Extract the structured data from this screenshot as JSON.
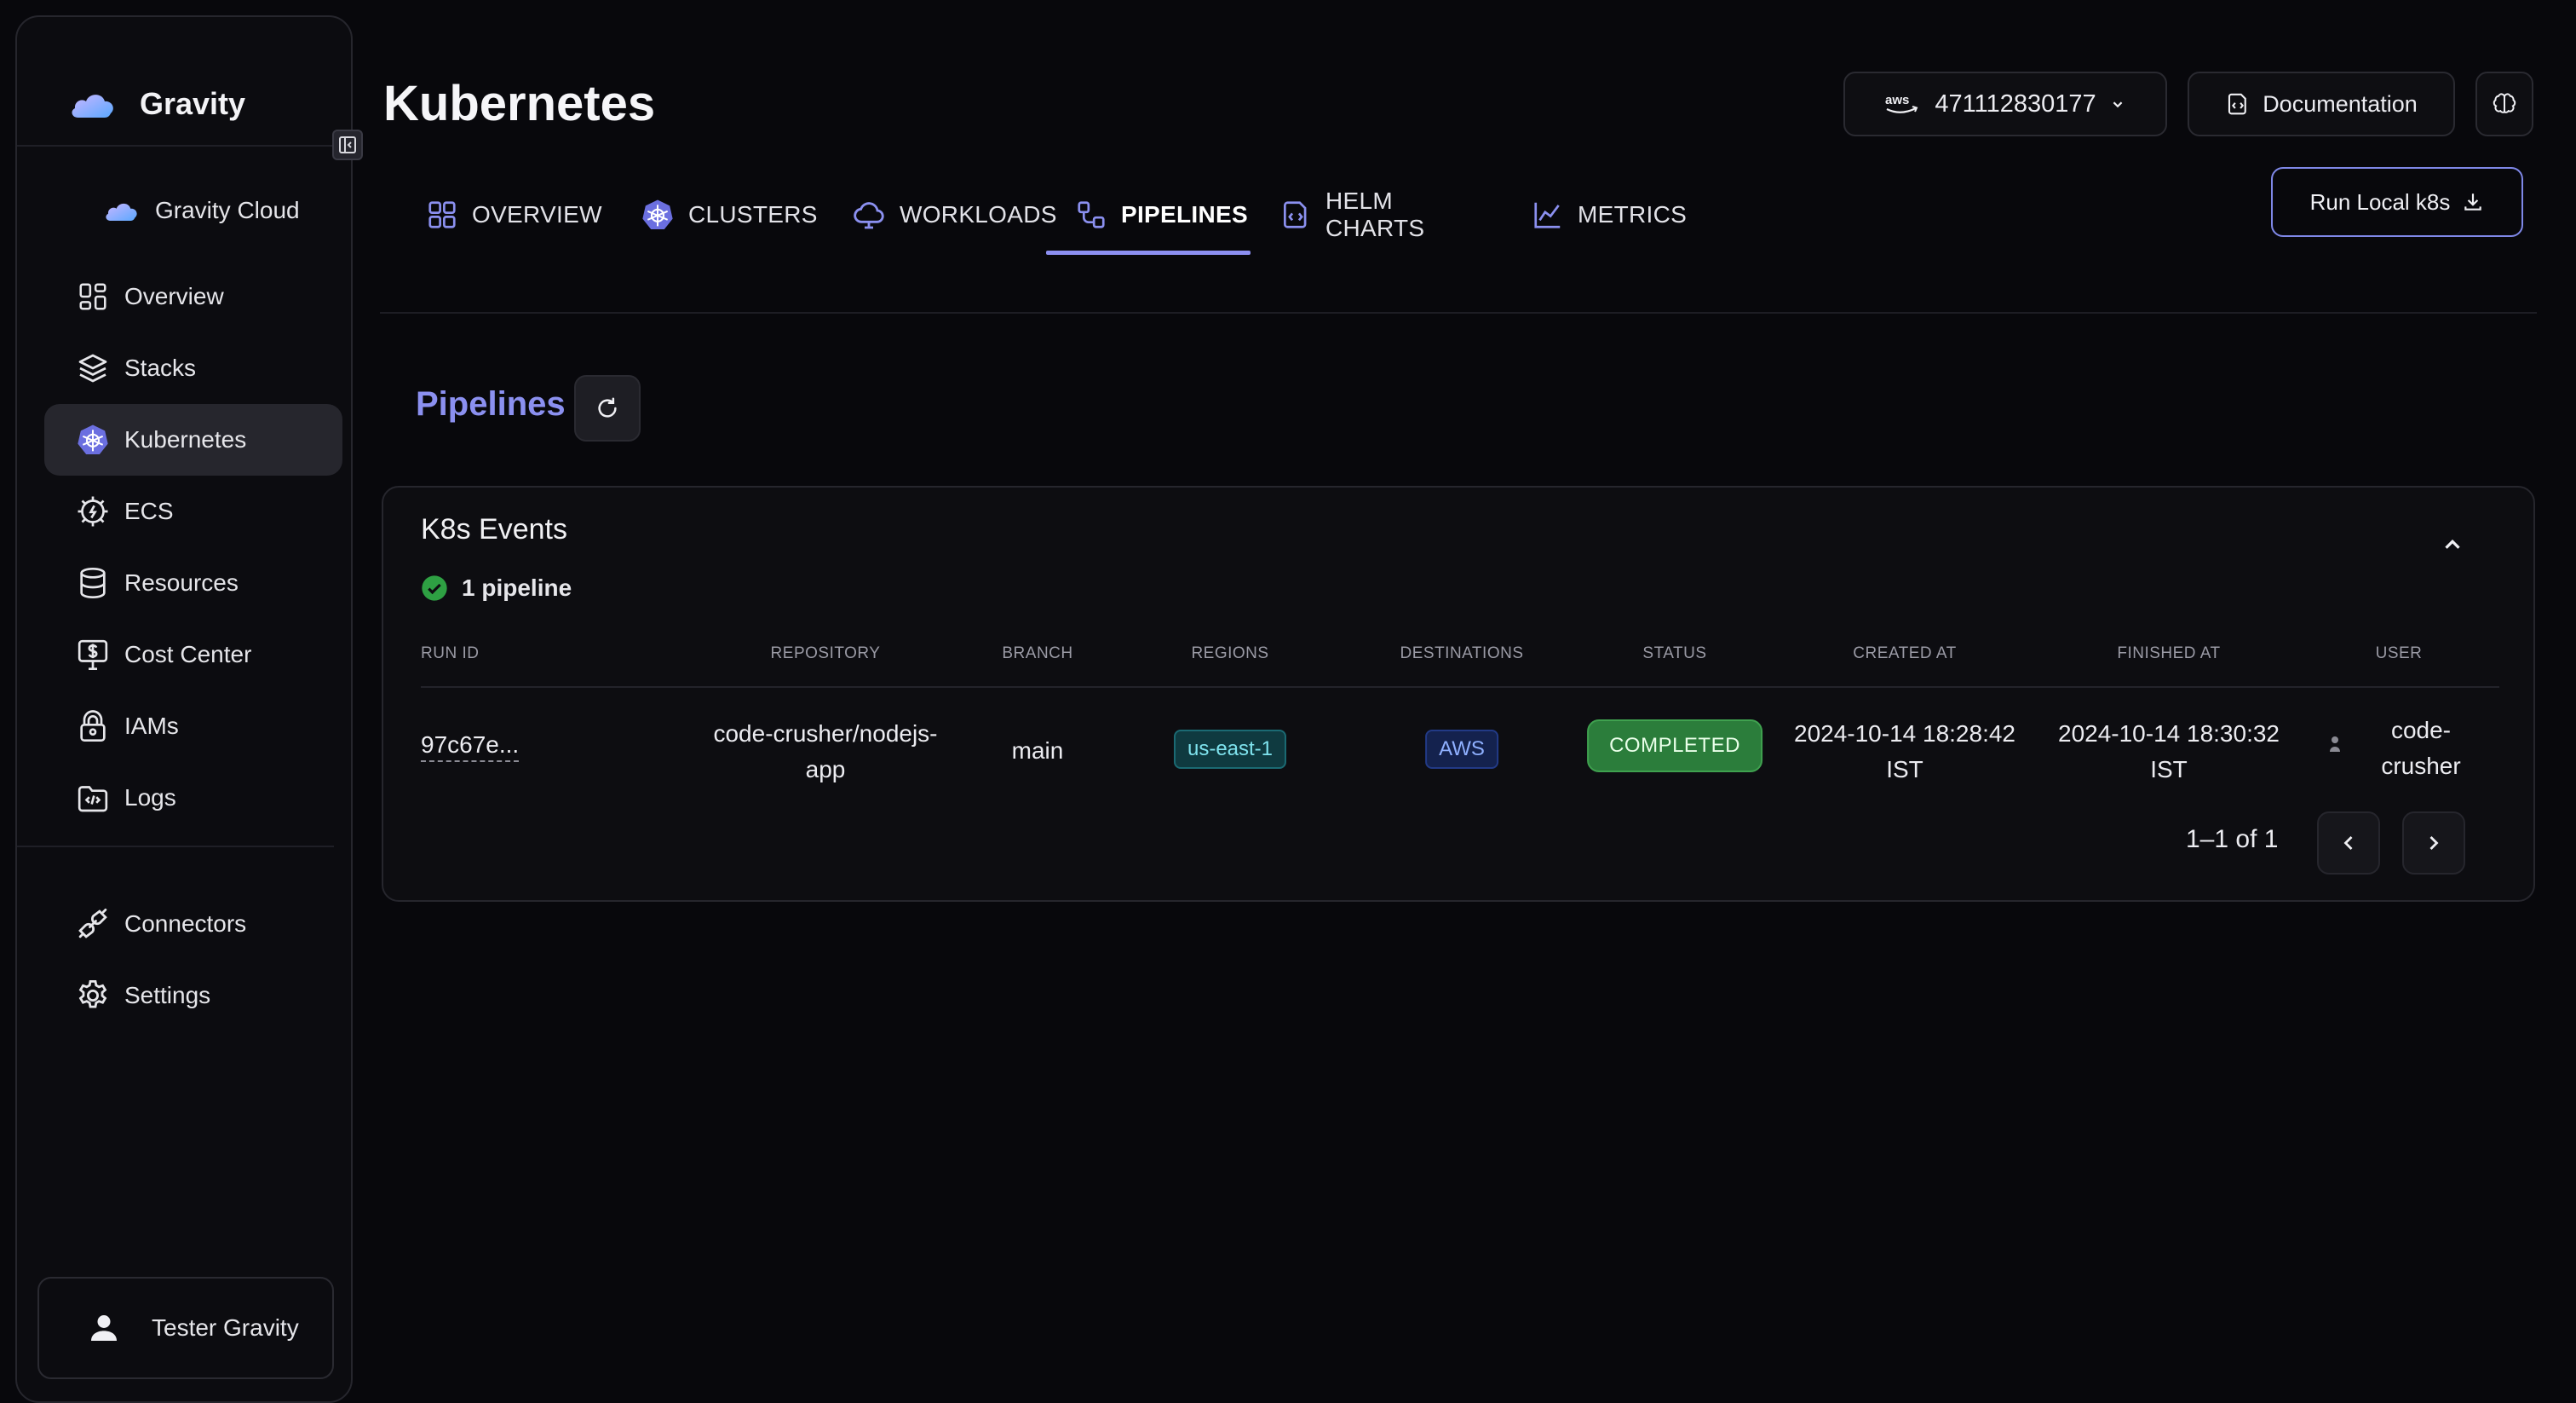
{
  "app": {
    "name": "Gravity",
    "workspace": "Gravity Cloud"
  },
  "sidebar": {
    "items": [
      {
        "label": "Overview",
        "icon": "overview-grid-icon"
      },
      {
        "label": "Stacks",
        "icon": "stacks-layers-icon"
      },
      {
        "label": "Kubernetes",
        "icon": "kubernetes-icon",
        "active": true
      },
      {
        "label": "ECS",
        "icon": "ecs-icon"
      },
      {
        "label": "Resources",
        "icon": "database-icon"
      },
      {
        "label": "Cost Center",
        "icon": "dollar-monitor-icon"
      },
      {
        "label": "IAMs",
        "icon": "lock-icon"
      },
      {
        "label": "Logs",
        "icon": "code-folder-icon"
      }
    ],
    "bottom_items": [
      {
        "label": "Connectors",
        "icon": "plug-icon"
      },
      {
        "label": "Settings",
        "icon": "gear-icon"
      }
    ],
    "user": {
      "name": "Tester Gravity"
    }
  },
  "header": {
    "title": "Kubernetes",
    "account": {
      "provider": "aws",
      "id": "471112830177"
    },
    "documentation_label": "Documentation",
    "run_local_label": "Run Local k8s"
  },
  "tabs": [
    {
      "label": "OVERVIEW",
      "icon": "grid-icon"
    },
    {
      "label": "CLUSTERS",
      "icon": "kubernetes-icon"
    },
    {
      "label": "WORKLOADS",
      "icon": "cloud-icon"
    },
    {
      "label": "PIPELINES",
      "icon": "pipeline-icon",
      "active": true
    },
    {
      "label": "HELM CHARTS",
      "icon": "helm-icon"
    },
    {
      "label": "METRICS",
      "icon": "chart-icon"
    }
  ],
  "section": {
    "title": "Pipelines"
  },
  "card": {
    "title": "K8s Events",
    "pipeline_count": "1 pipeline",
    "columns": [
      "RUN ID",
      "REPOSITORY",
      "BRANCH",
      "REGIONS",
      "DESTINATIONS",
      "STATUS",
      "CREATED AT",
      "FINISHED AT",
      "USER"
    ],
    "rows": [
      {
        "run_id": "97c67e...",
        "repository_line1": "code-crusher/nodejs-",
        "repository_line2": "app",
        "branch": "main",
        "region": "us-east-1",
        "destination": "AWS",
        "status": "COMPLETED",
        "created_line1": "2024-10-14 18:28:42",
        "created_line2": "IST",
        "finished_line1": "2024-10-14 18:30:32",
        "finished_line2": "IST",
        "user_line1": "code-",
        "user_line2": "crusher"
      }
    ],
    "pagination": "1–1 of 1"
  },
  "colors": {
    "accent": "#8b90f0",
    "success": "#2b7d3b",
    "background": "#08080c"
  }
}
